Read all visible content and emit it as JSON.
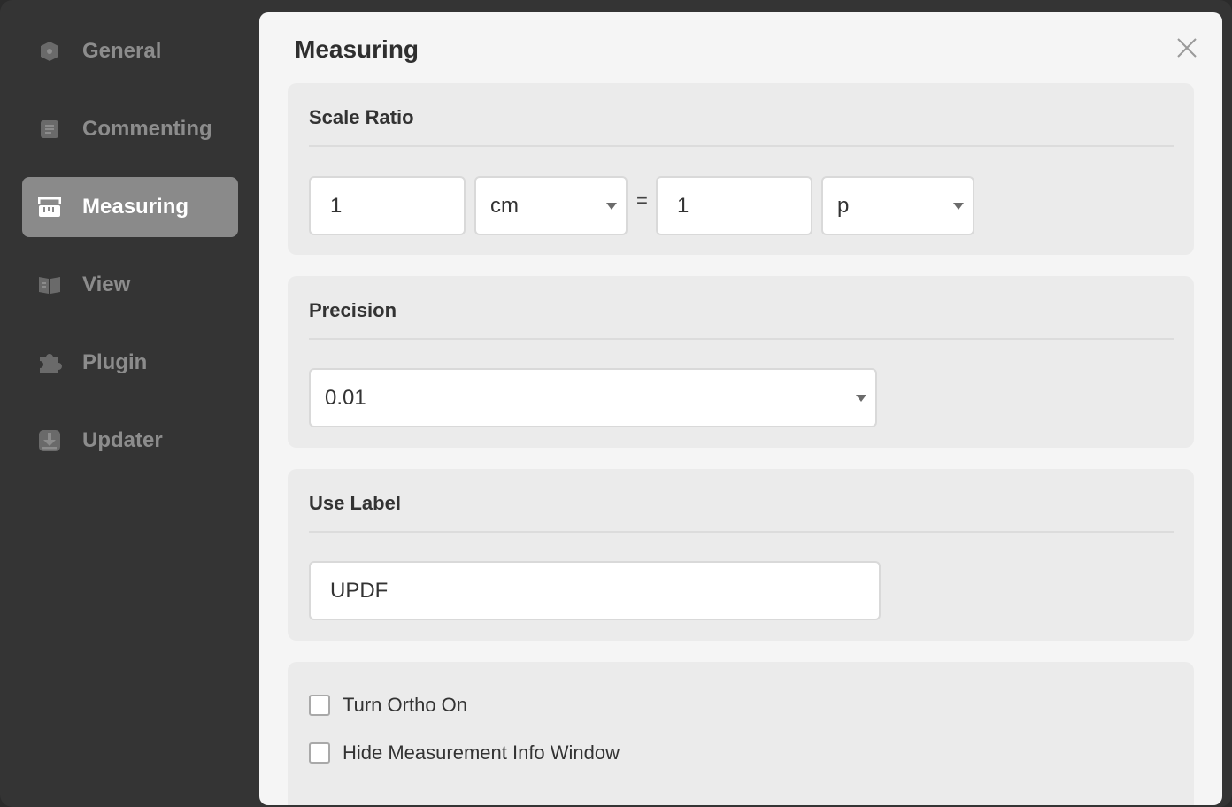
{
  "sidebar": {
    "items": [
      {
        "label": "General",
        "icon": "general-icon"
      },
      {
        "label": "Commenting",
        "icon": "commenting-icon"
      },
      {
        "label": "Measuring",
        "icon": "ruler-icon",
        "active": true
      },
      {
        "label": "View",
        "icon": "book-icon"
      },
      {
        "label": "Plugin",
        "icon": "puzzle-icon"
      },
      {
        "label": "Updater",
        "icon": "download-icon"
      }
    ]
  },
  "panel": {
    "title": "Measuring",
    "close_icon": "close-icon"
  },
  "scale_ratio": {
    "title": "Scale Ratio",
    "left_value": "1",
    "left_unit": "cm",
    "equals": "=",
    "right_value": "1",
    "right_unit": "p"
  },
  "precision": {
    "title": "Precision",
    "value": "0.01"
  },
  "use_label": {
    "title": "Use Label",
    "value": "UPDF"
  },
  "options": {
    "ortho_label": "Turn Ortho On",
    "ortho_checked": false,
    "hide_info_label": "Hide Measurement Info Window",
    "hide_info_checked": false
  },
  "colors": {
    "sidebar_bg": "#343434",
    "active_item_bg": "#8a8a8a",
    "panel_bg": "#f5f5f5",
    "section_bg": "#ebebeb"
  }
}
